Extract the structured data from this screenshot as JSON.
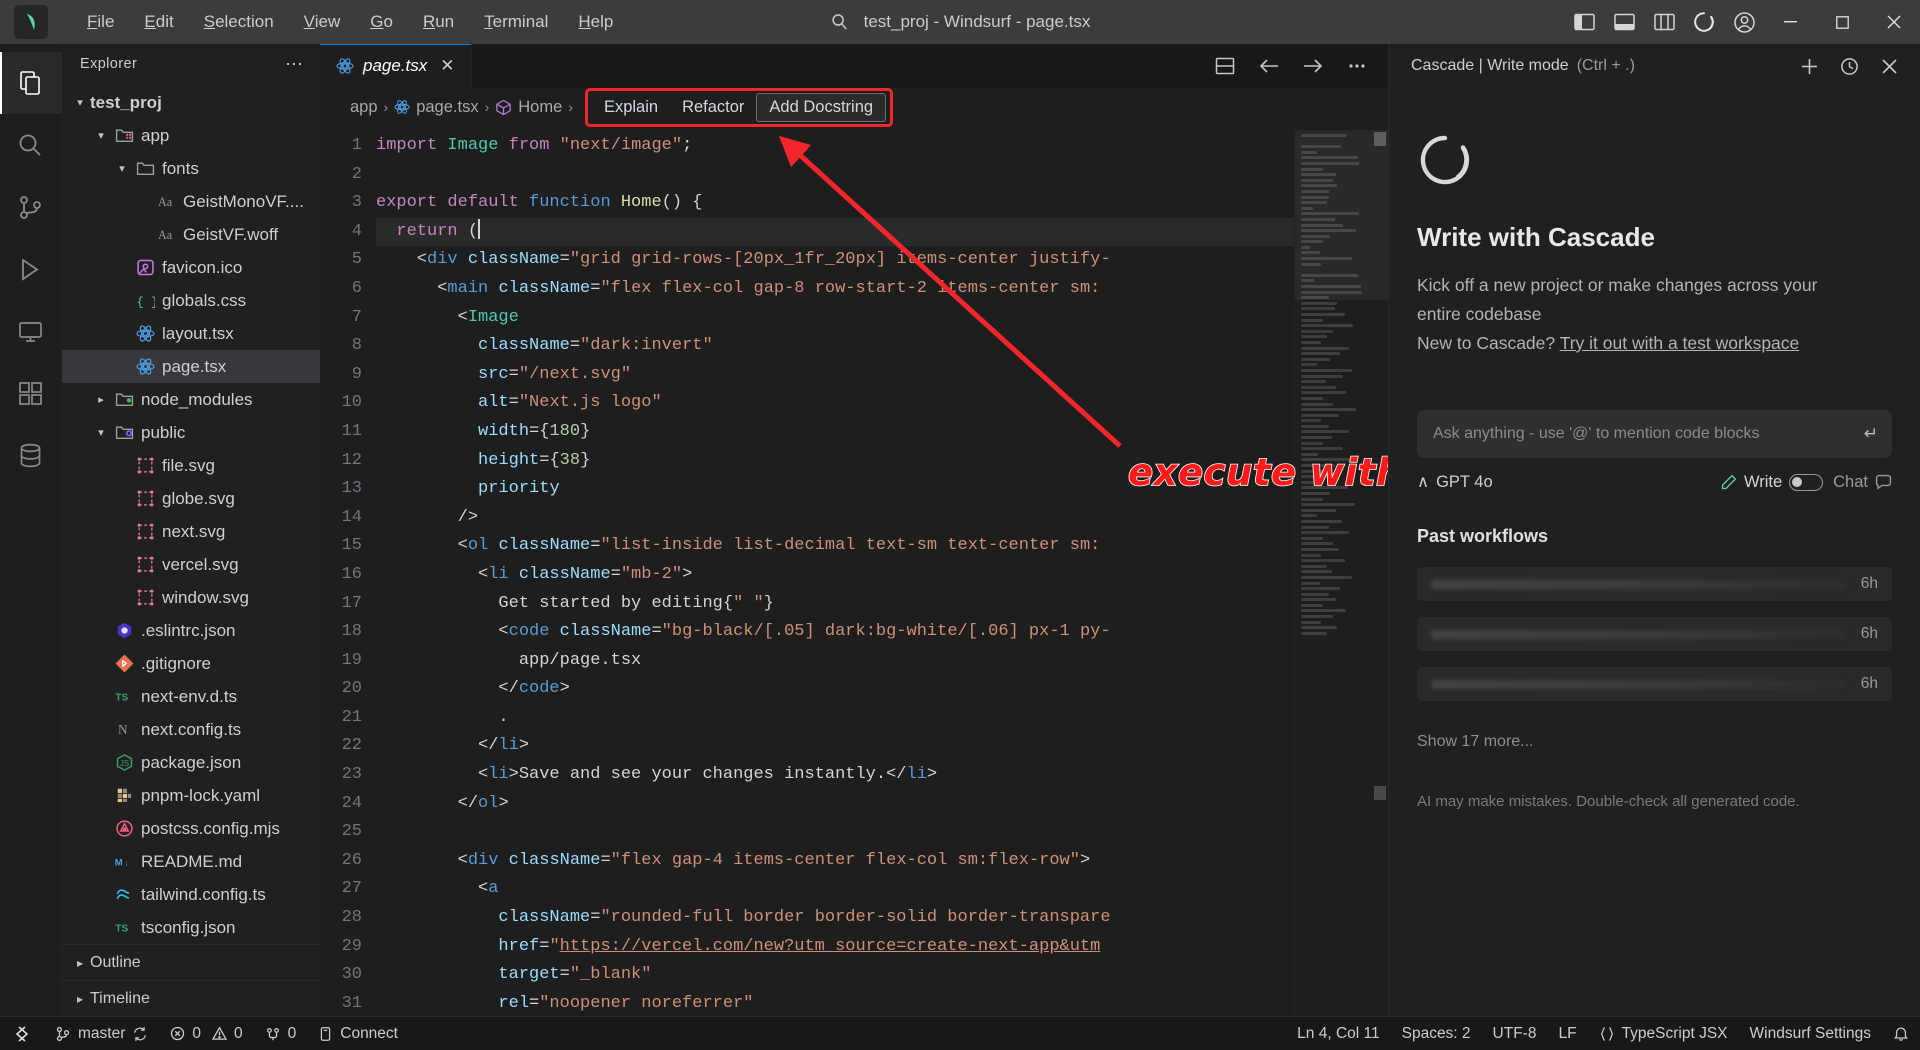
{
  "titlebar": {
    "logo_icon": "windsurf-logo-icon",
    "menus": [
      {
        "pre": "",
        "mn": "F",
        "post": "ile"
      },
      {
        "pre": "",
        "mn": "E",
        "post": "dit"
      },
      {
        "pre": "",
        "mn": "S",
        "post": "election"
      },
      {
        "pre": "",
        "mn": "V",
        "post": "iew"
      },
      {
        "pre": "",
        "mn": "G",
        "post": "o"
      },
      {
        "pre": "",
        "mn": "R",
        "post": "un"
      },
      {
        "pre": "",
        "mn": "T",
        "post": "erminal"
      },
      {
        "pre": "",
        "mn": "H",
        "post": "elp"
      }
    ],
    "search_icon": "search-icon",
    "window_title": "test_proj - Windsurf - page.tsx",
    "layout_icons": [
      "panel-left-icon",
      "panel-bottom-icon",
      "layout-grid-icon",
      "windsurf-circle-icon",
      "account-icon"
    ],
    "minimize": "─",
    "maximize": "☐",
    "close": "✕"
  },
  "activitybar": {
    "items": [
      {
        "name": "explorer",
        "icon": "files-icon",
        "active": true
      },
      {
        "name": "search",
        "icon": "search-icon",
        "active": false
      },
      {
        "name": "source-control",
        "icon": "source-control-icon",
        "active": false
      },
      {
        "name": "run-and-debug",
        "icon": "debug-icon",
        "active": false
      },
      {
        "name": "remote-explorer",
        "icon": "remote-icon",
        "active": false
      },
      {
        "name": "extensions",
        "icon": "extensions-icon",
        "active": false
      },
      {
        "name": "database",
        "icon": "database-icon",
        "active": false
      }
    ]
  },
  "sidebar": {
    "header": "Explorer",
    "more_actions": "⋯",
    "tree": [
      {
        "label": "test_proj",
        "depth": 0,
        "kind": "root",
        "chev": "down",
        "icon": "none"
      },
      {
        "label": "app",
        "depth": 1,
        "kind": "folder",
        "chev": "down",
        "icon": "folder-app-icon"
      },
      {
        "label": "fonts",
        "depth": 2,
        "kind": "folder",
        "chev": "down",
        "icon": "folder-icon"
      },
      {
        "label": "GeistMonoVF....",
        "depth": 3,
        "kind": "file",
        "chev": "",
        "icon": "font-icon"
      },
      {
        "label": "GeistVF.woff",
        "depth": 3,
        "kind": "file",
        "chev": "",
        "icon": "font-icon"
      },
      {
        "label": "favicon.ico",
        "depth": 2,
        "kind": "file",
        "chev": "",
        "icon": "image-icon"
      },
      {
        "label": "globals.css",
        "depth": 2,
        "kind": "file",
        "chev": "",
        "icon": "css-icon"
      },
      {
        "label": "layout.tsx",
        "depth": 2,
        "kind": "file",
        "chev": "",
        "icon": "react-icon"
      },
      {
        "label": "page.tsx",
        "depth": 2,
        "kind": "file",
        "chev": "",
        "icon": "react-icon",
        "selected": true
      },
      {
        "label": "node_modules",
        "depth": 1,
        "kind": "folder",
        "chev": "right",
        "icon": "folder-node-icon"
      },
      {
        "label": "public",
        "depth": 1,
        "kind": "folder",
        "chev": "down",
        "icon": "folder-public-icon"
      },
      {
        "label": "file.svg",
        "depth": 2,
        "kind": "file",
        "chev": "",
        "icon": "svg-icon"
      },
      {
        "label": "globe.svg",
        "depth": 2,
        "kind": "file",
        "chev": "",
        "icon": "svg-icon"
      },
      {
        "label": "next.svg",
        "depth": 2,
        "kind": "file",
        "chev": "",
        "icon": "svg-icon"
      },
      {
        "label": "vercel.svg",
        "depth": 2,
        "kind": "file",
        "chev": "",
        "icon": "svg-icon"
      },
      {
        "label": "window.svg",
        "depth": 2,
        "kind": "file",
        "chev": "",
        "icon": "svg-icon"
      },
      {
        "label": ".eslintrc.json",
        "depth": 1,
        "kind": "file",
        "chev": "",
        "icon": "eslint-icon"
      },
      {
        "label": ".gitignore",
        "depth": 1,
        "kind": "file",
        "chev": "",
        "icon": "git-icon"
      },
      {
        "label": "next-env.d.ts",
        "depth": 1,
        "kind": "file",
        "chev": "",
        "icon": "ts-icon"
      },
      {
        "label": "next.config.ts",
        "depth": 1,
        "kind": "file",
        "chev": "",
        "icon": "next-icon"
      },
      {
        "label": "package.json",
        "depth": 1,
        "kind": "file",
        "chev": "",
        "icon": "node-icon"
      },
      {
        "label": "pnpm-lock.yaml",
        "depth": 1,
        "kind": "file",
        "chev": "",
        "icon": "yaml-icon"
      },
      {
        "label": "postcss.config.mjs",
        "depth": 1,
        "kind": "file",
        "chev": "",
        "icon": "postcss-icon"
      },
      {
        "label": "README.md",
        "depth": 1,
        "kind": "file",
        "chev": "",
        "icon": "markdown-icon"
      },
      {
        "label": "tailwind.config.ts",
        "depth": 1,
        "kind": "file",
        "chev": "",
        "icon": "tailwind-icon"
      },
      {
        "label": "tsconfig.json",
        "depth": 1,
        "kind": "file",
        "chev": "",
        "icon": "ts-icon"
      }
    ],
    "sections": [
      {
        "label": "Outline",
        "chev": "right"
      },
      {
        "label": "Timeline",
        "chev": "right"
      }
    ]
  },
  "editor": {
    "tab": {
      "name": "page.tsx",
      "icon": "react-icon",
      "close": "✕"
    },
    "tab_actions": [
      "split-editor-icon",
      "back-arrow-icon",
      "forward-arrow-icon",
      "more-actions-icon"
    ],
    "breadcrumbs": [
      {
        "label": "app",
        "icon": ""
      },
      {
        "label": "page.tsx",
        "icon": "react-icon"
      },
      {
        "label": "Home",
        "icon": "symbol-function-icon"
      }
    ],
    "separator": "›",
    "codelens": [
      {
        "label": "Explain",
        "boxed": false
      },
      {
        "label": "Refactor",
        "boxed": false
      },
      {
        "label": "Add Docstring",
        "boxed": true
      }
    ],
    "highlight_color": "#f4262b",
    "annotation": "execute with one click",
    "first_line": 1,
    "lines": [
      {
        "n": 1,
        "tokens": [
          {
            "t": "import ",
            "c": "t-kw"
          },
          {
            "t": "Image ",
            "c": "t-cls"
          },
          {
            "t": "from ",
            "c": "t-kw"
          },
          {
            "t": "\"next/image\"",
            "c": "t-str"
          },
          {
            "t": ";",
            "c": "t-punc"
          }
        ]
      },
      {
        "n": 2,
        "tokens": []
      },
      {
        "n": 3,
        "tokens": [
          {
            "t": "export default ",
            "c": "t-kw"
          },
          {
            "t": "function ",
            "c": "t-kw2"
          },
          {
            "t": "Home",
            "c": "t-fn"
          },
          {
            "t": "() {",
            "c": "t-punc"
          }
        ]
      },
      {
        "n": 4,
        "tokens": [
          {
            "t": "  return ",
            "c": "t-kw"
          },
          {
            "t": "(",
            "c": "t-punc"
          }
        ],
        "current": true
      },
      {
        "n": 5,
        "tokens": [
          {
            "t": "    <",
            "c": "t-punc"
          },
          {
            "t": "div ",
            "c": "t-tag"
          },
          {
            "t": "className",
            "c": "t-attr"
          },
          {
            "t": "=",
            "c": "t-punc"
          },
          {
            "t": "\"grid grid-rows-[20px_1fr_20px] items-center justify-",
            "c": "t-str"
          }
        ]
      },
      {
        "n": 6,
        "tokens": [
          {
            "t": "      <",
            "c": "t-punc"
          },
          {
            "t": "main ",
            "c": "t-tag"
          },
          {
            "t": "className",
            "c": "t-attr"
          },
          {
            "t": "=",
            "c": "t-punc"
          },
          {
            "t": "\"flex flex-col gap-8 row-start-2 items-center sm:",
            "c": "t-str"
          }
        ]
      },
      {
        "n": 7,
        "tokens": [
          {
            "t": "        <",
            "c": "t-punc"
          },
          {
            "t": "Image",
            "c": "t-cls"
          }
        ]
      },
      {
        "n": 8,
        "tokens": [
          {
            "t": "          ",
            "c": "t-punc"
          },
          {
            "t": "className",
            "c": "t-attr"
          },
          {
            "t": "=",
            "c": "t-punc"
          },
          {
            "t": "\"dark:invert\"",
            "c": "t-str"
          }
        ]
      },
      {
        "n": 9,
        "tokens": [
          {
            "t": "          ",
            "c": "t-punc"
          },
          {
            "t": "src",
            "c": "t-attr"
          },
          {
            "t": "=",
            "c": "t-punc"
          },
          {
            "t": "\"/next.svg\"",
            "c": "t-str"
          }
        ]
      },
      {
        "n": 10,
        "tokens": [
          {
            "t": "          ",
            "c": "t-punc"
          },
          {
            "t": "alt",
            "c": "t-attr"
          },
          {
            "t": "=",
            "c": "t-punc"
          },
          {
            "t": "\"Next.js logo\"",
            "c": "t-str"
          }
        ]
      },
      {
        "n": 11,
        "tokens": [
          {
            "t": "          ",
            "c": "t-punc"
          },
          {
            "t": "width",
            "c": "t-attr"
          },
          {
            "t": "={",
            "c": "t-punc"
          },
          {
            "t": "180",
            "c": "t-num"
          },
          {
            "t": "}",
            "c": "t-punc"
          }
        ]
      },
      {
        "n": 12,
        "tokens": [
          {
            "t": "          ",
            "c": "t-punc"
          },
          {
            "t": "height",
            "c": "t-attr"
          },
          {
            "t": "={",
            "c": "t-punc"
          },
          {
            "t": "38",
            "c": "t-num"
          },
          {
            "t": "}",
            "c": "t-punc"
          }
        ]
      },
      {
        "n": 13,
        "tokens": [
          {
            "t": "          ",
            "c": "t-punc"
          },
          {
            "t": "priority",
            "c": "t-attr"
          }
        ]
      },
      {
        "n": 14,
        "tokens": [
          {
            "t": "        />",
            "c": "t-punc"
          }
        ]
      },
      {
        "n": 15,
        "tokens": [
          {
            "t": "        <",
            "c": "t-punc"
          },
          {
            "t": "ol ",
            "c": "t-tag"
          },
          {
            "t": "className",
            "c": "t-attr"
          },
          {
            "t": "=",
            "c": "t-punc"
          },
          {
            "t": "\"list-inside list-decimal text-sm text-center sm:",
            "c": "t-str"
          }
        ]
      },
      {
        "n": 16,
        "tokens": [
          {
            "t": "          <",
            "c": "t-punc"
          },
          {
            "t": "li ",
            "c": "t-tag"
          },
          {
            "t": "className",
            "c": "t-attr"
          },
          {
            "t": "=",
            "c": "t-punc"
          },
          {
            "t": "\"mb-2\"",
            "c": "t-str"
          },
          {
            "t": ">",
            "c": "t-punc"
          }
        ]
      },
      {
        "n": 17,
        "tokens": [
          {
            "t": "            Get started by editing",
            "c": "t-txt"
          },
          {
            "t": "{",
            "c": "t-punc"
          },
          {
            "t": "\" \"",
            "c": "t-str"
          },
          {
            "t": "}",
            "c": "t-punc"
          }
        ]
      },
      {
        "n": 18,
        "tokens": [
          {
            "t": "            <",
            "c": "t-punc"
          },
          {
            "t": "code ",
            "c": "t-tag"
          },
          {
            "t": "className",
            "c": "t-attr"
          },
          {
            "t": "=",
            "c": "t-punc"
          },
          {
            "t": "\"bg-black/[.05] dark:bg-white/[.06] px-1 py-",
            "c": "t-str"
          }
        ]
      },
      {
        "n": 19,
        "tokens": [
          {
            "t": "              app/page.tsx",
            "c": "t-txt"
          }
        ]
      },
      {
        "n": 20,
        "tokens": [
          {
            "t": "            </",
            "c": "t-punc"
          },
          {
            "t": "code",
            "c": "t-tag"
          },
          {
            "t": ">",
            "c": "t-punc"
          }
        ]
      },
      {
        "n": 21,
        "tokens": [
          {
            "t": "            .",
            "c": "t-txt"
          }
        ]
      },
      {
        "n": 22,
        "tokens": [
          {
            "t": "          </",
            "c": "t-punc"
          },
          {
            "t": "li",
            "c": "t-tag"
          },
          {
            "t": ">",
            "c": "t-punc"
          }
        ]
      },
      {
        "n": 23,
        "tokens": [
          {
            "t": "          <",
            "c": "t-punc"
          },
          {
            "t": "li",
            "c": "t-tag"
          },
          {
            "t": ">",
            "c": "t-punc"
          },
          {
            "t": "Save and see your changes instantly.",
            "c": "t-txt"
          },
          {
            "t": "</",
            "c": "t-punc"
          },
          {
            "t": "li",
            "c": "t-tag"
          },
          {
            "t": ">",
            "c": "t-punc"
          }
        ]
      },
      {
        "n": 24,
        "tokens": [
          {
            "t": "        </",
            "c": "t-punc"
          },
          {
            "t": "ol",
            "c": "t-tag"
          },
          {
            "t": ">",
            "c": "t-punc"
          }
        ]
      },
      {
        "n": 25,
        "tokens": []
      },
      {
        "n": 26,
        "tokens": [
          {
            "t": "        <",
            "c": "t-punc"
          },
          {
            "t": "div ",
            "c": "t-tag"
          },
          {
            "t": "className",
            "c": "t-attr"
          },
          {
            "t": "=",
            "c": "t-punc"
          },
          {
            "t": "\"flex gap-4 items-center flex-col sm:flex-row\"",
            "c": "t-str"
          },
          {
            "t": ">",
            "c": "t-punc"
          }
        ]
      },
      {
        "n": 27,
        "tokens": [
          {
            "t": "          <",
            "c": "t-punc"
          },
          {
            "t": "a",
            "c": "t-tag"
          }
        ]
      },
      {
        "n": 28,
        "tokens": [
          {
            "t": "            ",
            "c": "t-punc"
          },
          {
            "t": "className",
            "c": "t-attr"
          },
          {
            "t": "=",
            "c": "t-punc"
          },
          {
            "t": "\"rounded-full border border-solid border-transpare",
            "c": "t-str"
          }
        ]
      },
      {
        "n": 29,
        "tokens": [
          {
            "t": "            ",
            "c": "t-punc"
          },
          {
            "t": "href",
            "c": "t-attr"
          },
          {
            "t": "=",
            "c": "t-punc"
          },
          {
            "t": "\"",
            "c": "t-str"
          },
          {
            "t": "https://vercel.com/new?utm_source=create-next-app&utm",
            "c": "t-link"
          }
        ]
      },
      {
        "n": 30,
        "tokens": [
          {
            "t": "            ",
            "c": "t-punc"
          },
          {
            "t": "target",
            "c": "t-attr"
          },
          {
            "t": "=",
            "c": "t-punc"
          },
          {
            "t": "\"_blank\"",
            "c": "t-str"
          }
        ]
      },
      {
        "n": 31,
        "tokens": [
          {
            "t": "            ",
            "c": "t-punc"
          },
          {
            "t": "rel",
            "c": "t-attr"
          },
          {
            "t": "=",
            "c": "t-punc"
          },
          {
            "t": "\"noopener noreferrer\"",
            "c": "t-str"
          }
        ]
      }
    ]
  },
  "cascade": {
    "title": "Cascade | Write mode",
    "shortcut": "(Ctrl + .)",
    "header_icons": [
      "new-chat-icon",
      "history-icon",
      "close-icon"
    ],
    "heading": "Write with Cascade",
    "description_line1": "Kick off a new project or make changes across your",
    "description_line2": "entire codebase",
    "new_prefix": "New to Cascade?",
    "new_link": "Try it out with a test workspace",
    "input_placeholder": "Ask anything - use '@' to mention code blocks",
    "input_value": "",
    "enter_icon": "enter-key-icon",
    "model": "GPT 4o",
    "model_chevron": "∧",
    "write_label": "Write",
    "chat_label": "Chat",
    "workflows_title": "Past workflows",
    "workflows": [
      {
        "age": "6h"
      },
      {
        "age": "6h"
      },
      {
        "age": "6h"
      }
    ],
    "show_more": "Show 17 more...",
    "disclaimer": "AI may make mistakes. Double-check all generated code."
  },
  "statusbar": {
    "remote_icon": "remote-indicator-icon",
    "left": [
      {
        "icon": "source-control-icon",
        "label": "master",
        "extra_icon": "sync-icon"
      },
      {
        "icon": "error-icon",
        "label": "0",
        "icon2": "warning-icon",
        "label2": "0"
      },
      {
        "icon": "ports-icon",
        "label": "0"
      },
      {
        "icon": "plug-icon",
        "label": "Connect"
      }
    ],
    "right": [
      {
        "label": "Ln 4, Col 11"
      },
      {
        "label": "Spaces: 2"
      },
      {
        "label": "UTF-8"
      },
      {
        "label": "LF"
      },
      {
        "label": "TypeScript JSX",
        "icon": "braces-icon"
      },
      {
        "label": "Windsurf Settings"
      },
      {
        "label": "",
        "icon": "bell-icon"
      }
    ]
  }
}
